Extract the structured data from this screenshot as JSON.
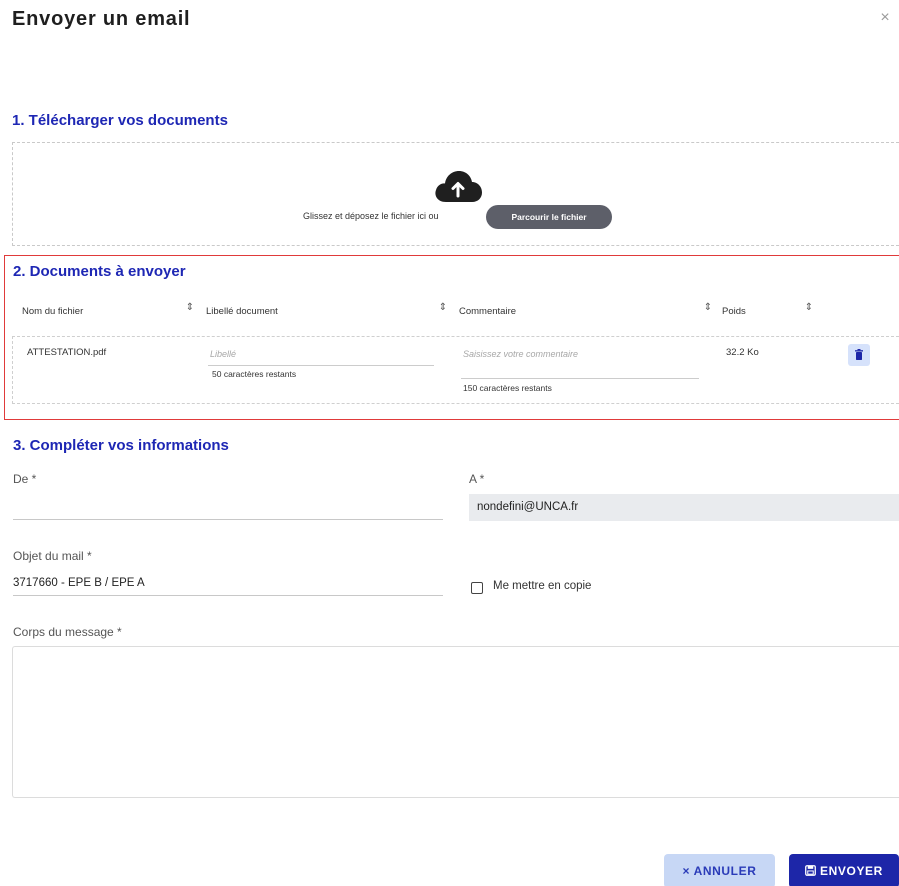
{
  "modal": {
    "title": "Envoyer un email",
    "close_symbol": "×"
  },
  "upload": {
    "section_title": "1. Télécharger vos documents",
    "icon": "cloud-upload-icon",
    "drop_text": "Glissez et déposez le fichier ici ou",
    "browse_label": "Parcourir le fichier"
  },
  "documents": {
    "section_title": "2. Documents à envoyer",
    "columns": [
      "Nom du fichier",
      "Libellé document",
      "Commentaire",
      "Poids"
    ],
    "rows": [
      {
        "filename": "ATTESTATION.pdf",
        "label_placeholder": "Libellé",
        "label_hint": "50 caractères restants",
        "comment_placeholder": "Saisissez votre commentaire",
        "comment_hint": "150 caractères restants",
        "size": "32.2 Ko",
        "delete_icon": "trash-icon"
      }
    ]
  },
  "info": {
    "section_title": "3. Compléter vos informations",
    "from_label": "De *",
    "from_value": "",
    "to_label": "A *",
    "to_value": "nondefini@UNCA.fr",
    "subject_label": "Objet du mail *",
    "subject_value": "3717660 - EPE B / EPE A",
    "copy_label": "Me mettre en copie",
    "copy_checked": false,
    "body_label": "Corps du message *",
    "body_value": ""
  },
  "actions": {
    "cancel_label": "× ANNULER",
    "send_label": "ENVOYER",
    "send_icon": "save-icon"
  },
  "colors": {
    "accent": "#1e27b4",
    "primary_button": "#1d26a8",
    "secondary_button": "#c7d7f5",
    "highlight_frame": "#e03a3a"
  }
}
